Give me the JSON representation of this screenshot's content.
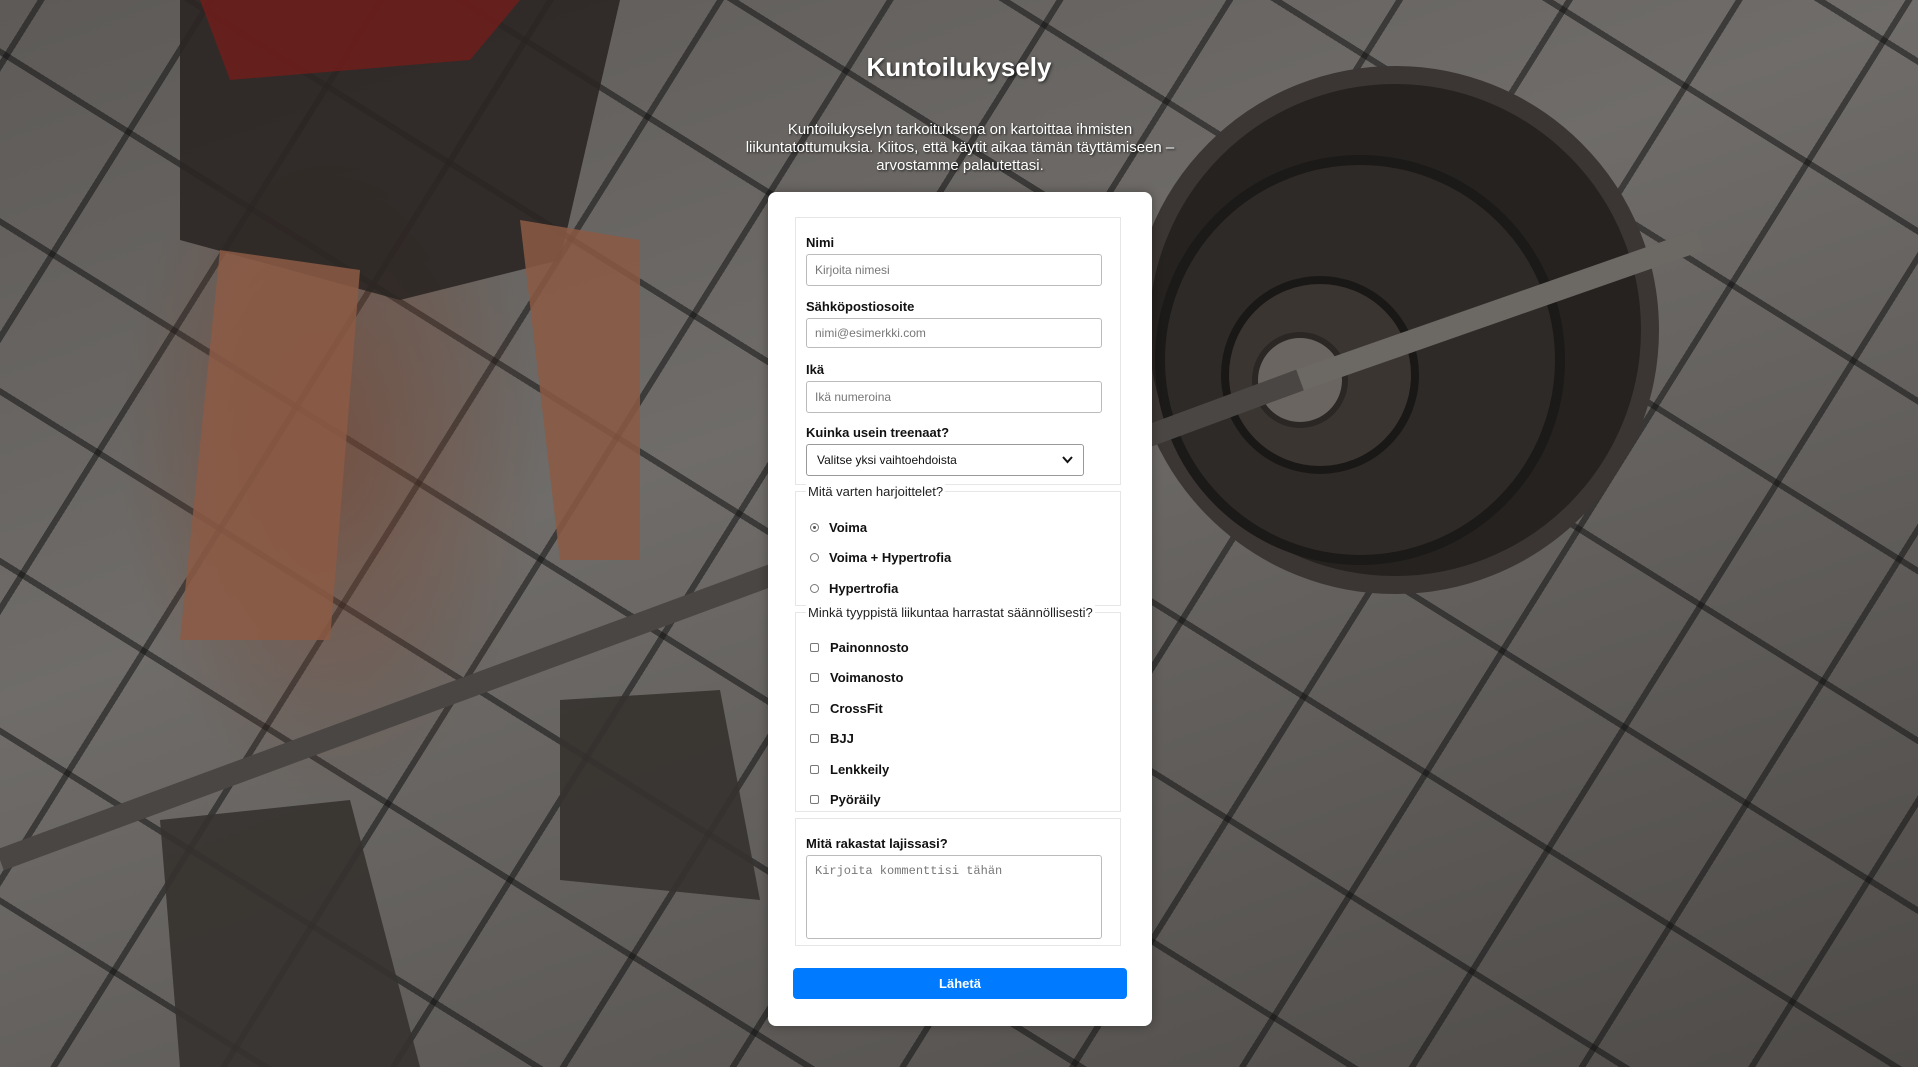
{
  "header": {
    "title": "Kuntoilukysely",
    "description": "Kuntoilukyselyn tarkoituksena on kartoittaa ihmisten liikuntatottumuksia. Kiitos, että käytit aikaa tämän täyttämiseen – arvostamme palautettasi."
  },
  "form": {
    "name_label": "Nimi",
    "name_placeholder": "Kirjoita nimesi",
    "email_label": "Sähköpostiosoite",
    "email_placeholder": "nimi@esimerkki.com",
    "age_label": "Ikä",
    "age_placeholder": "Ikä numeroina",
    "frequency_label": "Kuinka usein treenaat?",
    "frequency_selected": "Valitse yksi vaihtoehdoista",
    "goal_legend": "Mitä varten harjoittelet?",
    "goal_options": [
      "Voima",
      "Voima + Hypertrofia",
      "Hypertrofia"
    ],
    "goal_selected_index": 0,
    "sports_legend": "Minkä tyyppistä liikuntaa harrastat säännöllisesti?",
    "sports_options": [
      "Painonnosto",
      "Voimanosto",
      "CrossFit",
      "BJJ",
      "Lenkkeily",
      "Pyöräily"
    ],
    "comment_label": "Mitä rakastat lajissasi?",
    "comment_placeholder": "Kirjoita kommenttisi tähän",
    "submit_label": "Lähetä"
  },
  "colors": {
    "accent": "#007bff"
  }
}
